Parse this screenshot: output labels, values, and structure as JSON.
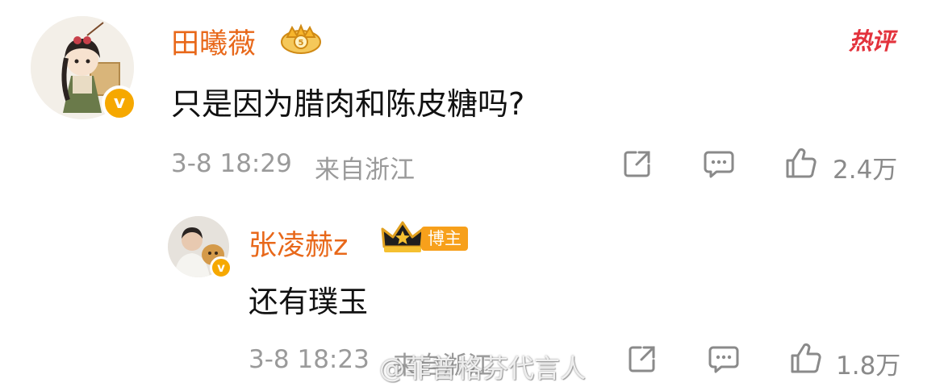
{
  "comment": {
    "username": "田曦薇",
    "text": "只是因为腊肉和陈皮糖吗?",
    "time": "3-8 18:29",
    "location": "来自浙江",
    "likes": "2.4万",
    "hot_label": "热评"
  },
  "reply": {
    "username": "张凌赫z",
    "role_badge": "博主",
    "text": "还有璞玉",
    "time": "3-8 18:23",
    "location": "来自浙江",
    "likes": "1.8万"
  },
  "watermark": "@菲普格芬代言人",
  "colors": {
    "username": "#e8681a",
    "verified": "#f6a800",
    "hot": "#e3323c",
    "meta": "#9a9a9a"
  },
  "icons": [
    "share-icon",
    "comment-icon",
    "like-icon",
    "verified-badge",
    "crown-icon"
  ]
}
